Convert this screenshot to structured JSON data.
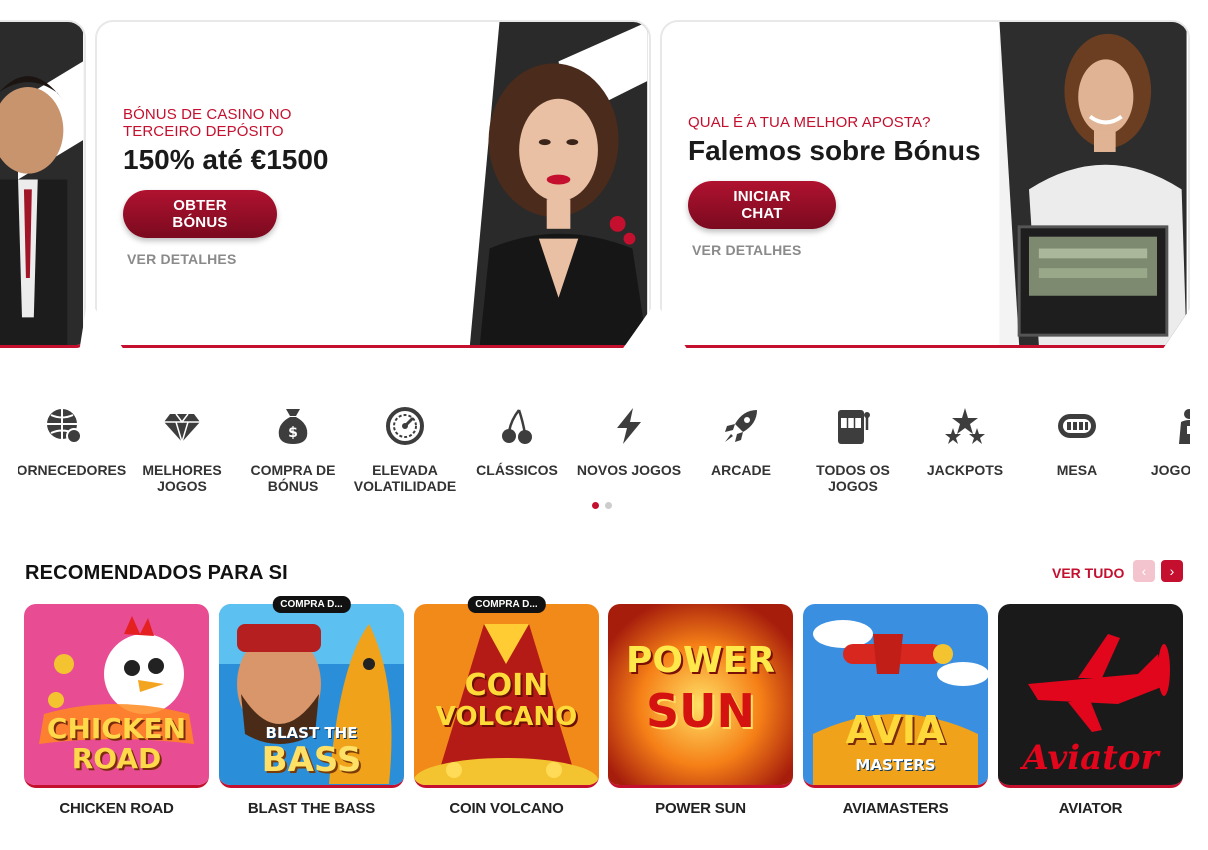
{
  "colors": {
    "accent": "#c4102e",
    "cta_gradient_top": "#b0122f",
    "cta_gradient_bottom": "#7a0a1f",
    "muted_text": "#8a8a8a",
    "dot_active": "#c4102e",
    "dot_inactive": "#cccccc"
  },
  "banners": [
    {
      "eyebrow": "BÓNUS DE CASINO NO TERCEIRO DEPÓSITO",
      "headline": "150% até €1500",
      "cta": "OBTER BÓNUS",
      "details": "VER DETALHES"
    },
    {
      "eyebrow": "QUAL É A TUA MELHOR APOSTA?",
      "headline": "Falemos sobre Bónus",
      "cta": "INICIAR CHAT",
      "details": "VER DETALHES"
    }
  ],
  "categories": [
    {
      "label": "FORNECEDORES",
      "icon": "globe-icon"
    },
    {
      "label": "MELHORES JOGOS",
      "icon": "diamond-icon"
    },
    {
      "label": "COMPRA DE BÓNUS",
      "icon": "money-bag-icon"
    },
    {
      "label": "ELEVADA VOLATILIDADE",
      "icon": "gauge-icon"
    },
    {
      "label": "CLÁSSICOS",
      "icon": "cherries-icon"
    },
    {
      "label": "NOVOS JOGOS",
      "icon": "lightning-icon"
    },
    {
      "label": "ARCADE",
      "icon": "rocket-icon"
    },
    {
      "label": "TODOS OS JOGOS",
      "icon": "slot-machine-icon"
    },
    {
      "label": "JACKPOTS",
      "icon": "jackpot-stars-icon"
    },
    {
      "label": "MESA",
      "icon": "table-icon"
    },
    {
      "label": "JOGOS VIV",
      "icon": "live-dealer-icon"
    }
  ],
  "carousel": {
    "active_page": 1,
    "total_pages": 2
  },
  "recommended": {
    "title": "RECOMENDADOS PARA SI",
    "see_all": "VER TUDO",
    "prev_icon": "chevron-left-icon",
    "next_icon": "chevron-right-icon",
    "games": [
      {
        "name": "CHICKEN ROAD",
        "badge": "",
        "art_line1": "CHICKEN",
        "art_line2": "ROAD"
      },
      {
        "name": "BLAST THE BASS",
        "badge": "COMPRA D...",
        "art_line1": "BLAST THE",
        "art_line2": "BASS"
      },
      {
        "name": "COIN VOLCANO",
        "badge": "COMPRA D...",
        "art_line1": "COIN",
        "art_line2": "VOLCANO"
      },
      {
        "name": "POWER SUN",
        "badge": "",
        "art_line1": "POWER",
        "art_line2": "SUN"
      },
      {
        "name": "AVIAMASTERS",
        "badge": "",
        "art_line1": "AVIA",
        "art_line2": "MASTERS"
      },
      {
        "name": "AVIATOR",
        "badge": "",
        "art_line1": "",
        "art_line2": "Aviator"
      }
    ]
  }
}
